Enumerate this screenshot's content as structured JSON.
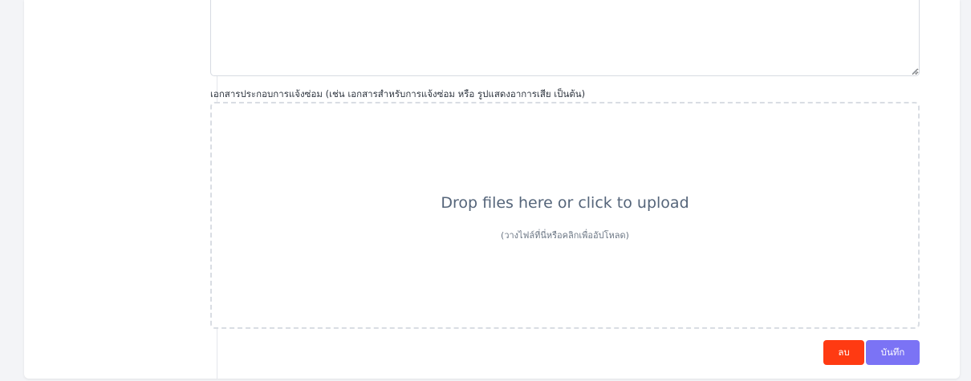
{
  "form": {
    "description_value": "",
    "attachments_label": "เอกสารประกอบการแจ้งซ่อม (เช่น เอกสารสำหรับการแจ้งซ่อม หรือ รูปแสดงอาการเสีย เป็นต้น)",
    "dropzone": {
      "title": "Drop files here or click to upload",
      "subtitle": "(วางไฟล์ที่นี่หรือคลิกเพื่ออัปโหลด)"
    }
  },
  "actions": {
    "delete_label": "ลบ",
    "save_label": "บันทึก"
  },
  "colors": {
    "delete_button": "#ff3a12",
    "save_button": "#7b73f5",
    "dropzone_border": "#d9dde3"
  }
}
